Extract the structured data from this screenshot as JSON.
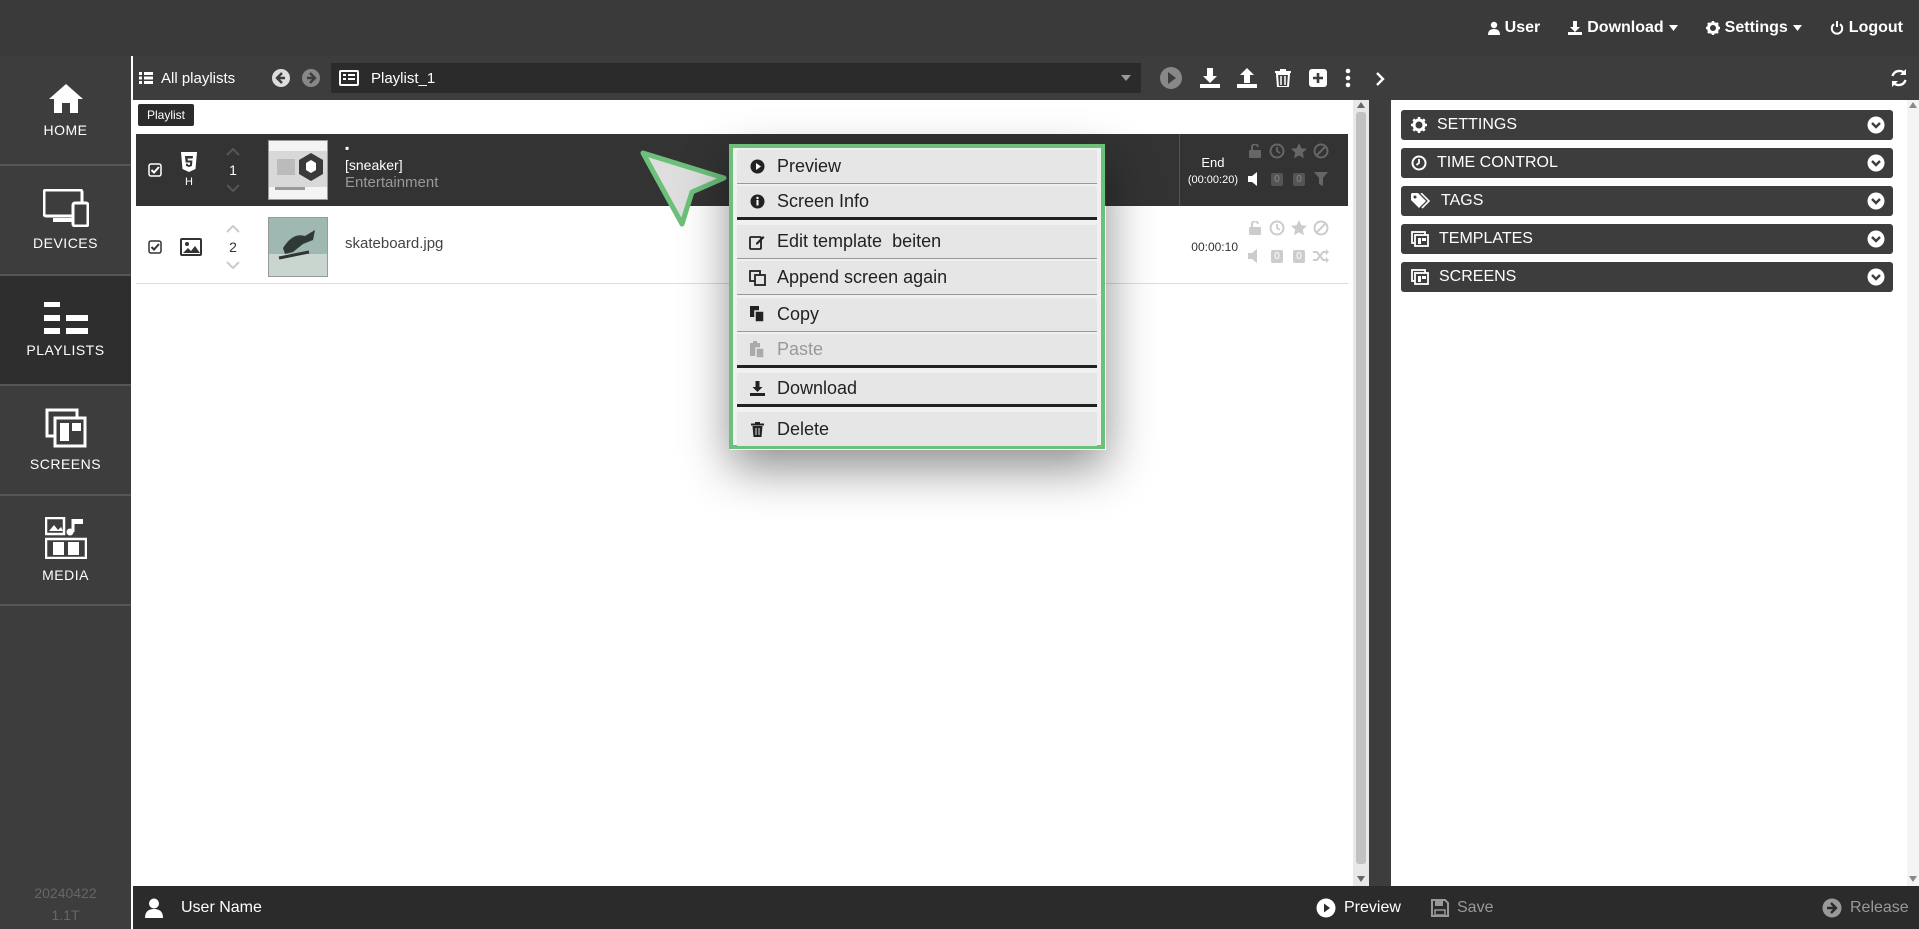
{
  "colors": {
    "topbar_bg": "#3a3a3a",
    "sidebar_bg": "#3d3d3d",
    "context_menu_border": "#6cc07a",
    "selected_row_bg": "#333333"
  },
  "topbar": {
    "user_label": "User",
    "download_label": "Download",
    "settings_label": "Settings",
    "logout_label": "Logout"
  },
  "sidebar": {
    "items": [
      {
        "label": "HOME",
        "icon": "home-icon"
      },
      {
        "label": "DEVICES",
        "icon": "devices-icon"
      },
      {
        "label": "PLAYLISTS",
        "icon": "playlists-icon"
      },
      {
        "label": "SCREENS",
        "icon": "screens-icon"
      },
      {
        "label": "MEDIA",
        "icon": "media-icon"
      }
    ],
    "active": "PLAYLISTS",
    "version_line1": "20240422",
    "version_line2": "1.1T"
  },
  "header": {
    "all_playlists_label": "All playlists",
    "selected_playlist": "Playlist_1"
  },
  "playlist": {
    "tab_label": "Playlist",
    "rows": [
      {
        "index": "1",
        "type_badge": "H",
        "type_icon": "html5-icon",
        "title_line1": "▪",
        "title_line2": "[sneaker]",
        "title_line3": "Entertainment",
        "end_label": "End",
        "duration": "(00:00:20)",
        "counter1": "0",
        "counter2": "0",
        "selected": true
      },
      {
        "index": "2",
        "type_icon": "image-icon",
        "title_line1": "skateboard.jpg",
        "duration": "00:00:10",
        "counter1": "0",
        "counter2": "0",
        "selected": false
      }
    ]
  },
  "context_menu": {
    "items": [
      {
        "label": "Preview",
        "icon": "play-circle-icon"
      },
      {
        "label": "Screen Info",
        "icon": "info-icon"
      },
      {
        "label": "Edit template",
        "suffix": "beiten",
        "icon": "edit-icon"
      },
      {
        "label": "Append screen again",
        "icon": "duplicate-icon"
      },
      {
        "label": "Copy",
        "icon": "copy-icon"
      },
      {
        "label": "Paste",
        "icon": "paste-icon",
        "disabled": true
      },
      {
        "label": "Download",
        "icon": "download-icon"
      },
      {
        "label": "Delete",
        "icon": "trash-icon"
      }
    ]
  },
  "right_panel": {
    "sections": [
      {
        "label": "SETTINGS",
        "icon": "gear-icon"
      },
      {
        "label": "TIME CONTROL",
        "icon": "clock-icon"
      },
      {
        "label": "TAGS",
        "icon": "tags-icon"
      },
      {
        "label": "TEMPLATES",
        "icon": "templates-icon"
      },
      {
        "label": "SCREENS",
        "icon": "screens-icon"
      }
    ]
  },
  "bottombar": {
    "user_name": "User Name",
    "preview_label": "Preview",
    "save_label": "Save",
    "release_label": "Release"
  }
}
